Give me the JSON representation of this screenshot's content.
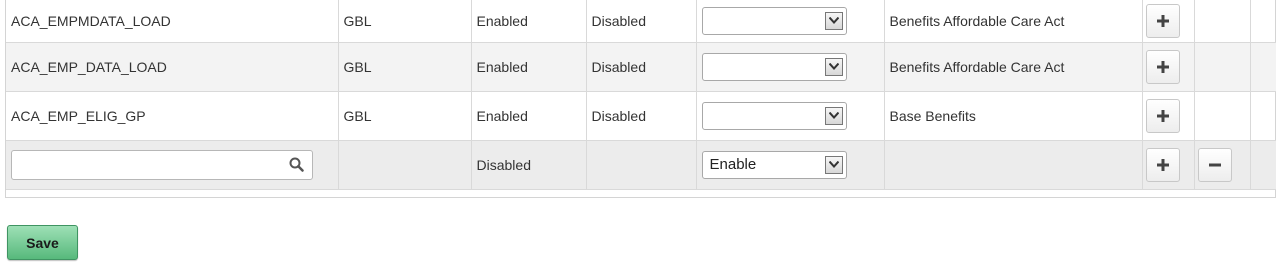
{
  "rows": [
    {
      "process": "ACA_EMPMDATA_LOAD",
      "setid": "GBL",
      "status": "Enabled",
      "override": "Disabled",
      "select_value": "",
      "description": "Benefits Affordable Care Act"
    },
    {
      "process": "ACA_EMP_DATA_LOAD",
      "setid": "GBL",
      "status": "Enabled",
      "override": "Disabled",
      "select_value": "",
      "description": "Benefits Affordable Care Act"
    },
    {
      "process": "ACA_EMP_ELIG_GP",
      "setid": "GBL",
      "status": "Enabled",
      "override": "Disabled",
      "select_value": "",
      "description": "Base Benefits"
    }
  ],
  "new_row": {
    "search_value": "",
    "status": "Disabled",
    "select_value": "Enable"
  },
  "icons": {
    "add": "plus-icon",
    "delete": "minus-icon",
    "lookup": "search-icon",
    "dropdown": "chevron-down-icon"
  },
  "actions": {
    "save_label": "Save"
  },
  "colors": {
    "save_button": "#6cc58c",
    "alt_row": "#f3f3f3",
    "new_row": "#ececec"
  }
}
